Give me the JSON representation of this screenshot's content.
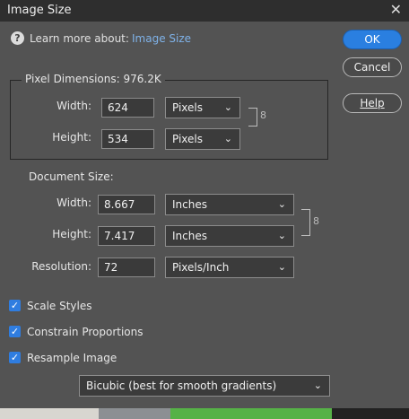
{
  "window": {
    "title": "Image Size",
    "close_glyph": "✕"
  },
  "learn": {
    "text": "Learn more about:",
    "link": "Image Size",
    "help_glyph": "?"
  },
  "pixel_dimensions": {
    "label": "Pixel Dimensions:",
    "size": "976.2K",
    "width_label": "Width:",
    "width_value": "624",
    "width_unit": "Pixels",
    "height_label": "Height:",
    "height_value": "534",
    "height_unit": "Pixels"
  },
  "document_size": {
    "label": "Document Size:",
    "width_label": "Width:",
    "width_value": "8.667",
    "width_unit": "Inches",
    "height_label": "Height:",
    "height_value": "7.417",
    "height_unit": "Inches",
    "resolution_label": "Resolution:",
    "resolution_value": "72",
    "resolution_unit": "Pixels/Inch"
  },
  "buttons": {
    "ok": "OK",
    "cancel": "Cancel",
    "help": "Help"
  },
  "options": {
    "scale_styles": {
      "label": "Scale Styles",
      "checked": true
    },
    "constrain_proportions": {
      "label": "Constrain Proportions",
      "checked": true
    },
    "resample_image": {
      "label": "Resample Image",
      "checked": true
    },
    "resample_method": "Bicubic (best for smooth gradients)"
  },
  "icons": {
    "chevron": "⌄",
    "link": "8",
    "check": "✓"
  },
  "colors": {
    "accent": "#2a7fe0",
    "dialog_bg": "#535353"
  }
}
